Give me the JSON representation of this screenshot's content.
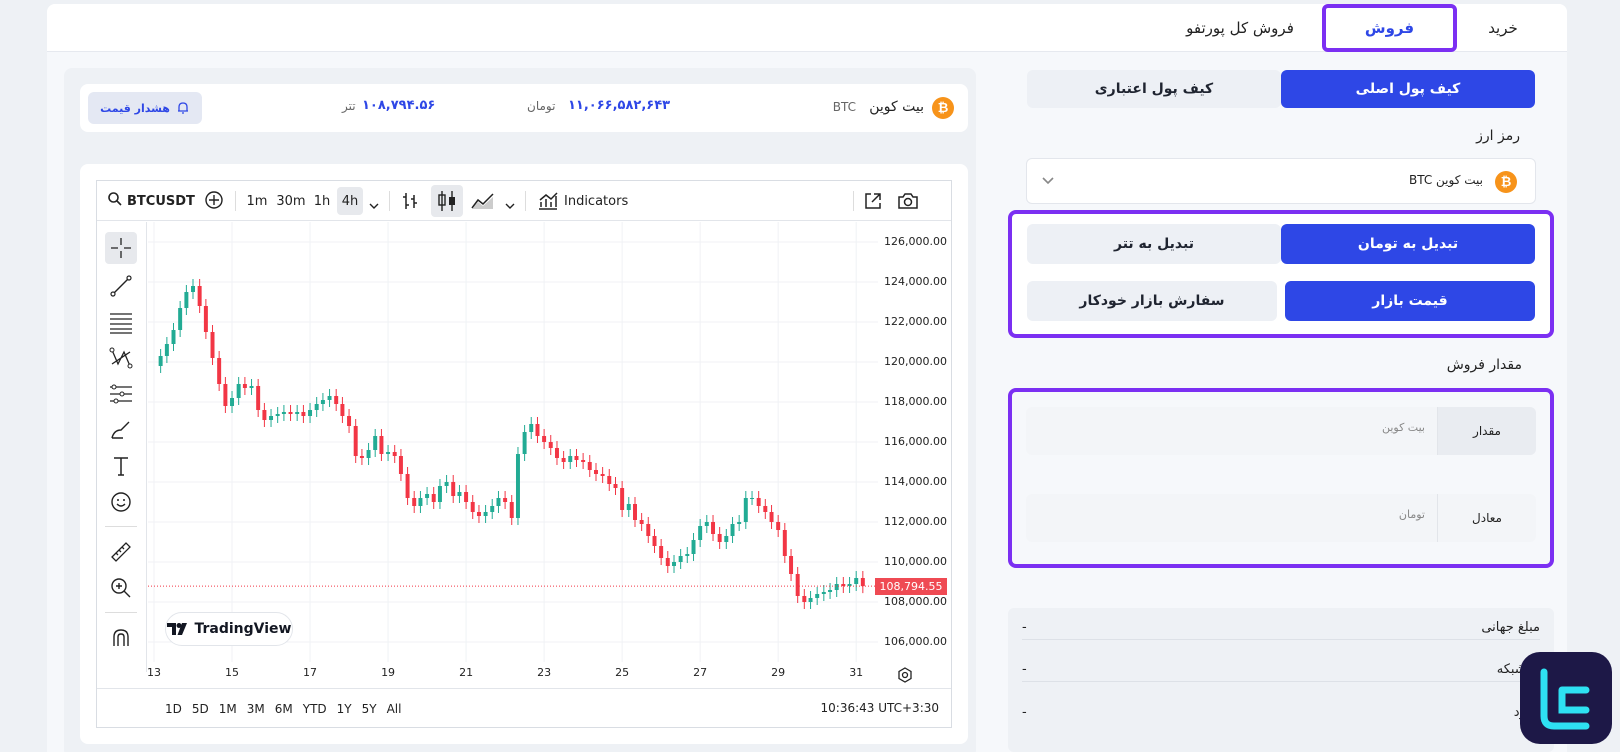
{
  "tabs": {
    "buy": "خرید",
    "sell": "فروش",
    "sell_all": "فروش کل پورتفو"
  },
  "wallet": {
    "main": "کیف پول اصلی",
    "credit": "کیف پول اعتباری"
  },
  "currency": {
    "label": "رمز ارز",
    "selected": "بیت کوین BTC",
    "coin_symbol": "₿"
  },
  "convert": {
    "to_toman": "تبدیل به تومان",
    "to_tether": "تبدیل به تتر"
  },
  "order_type": {
    "market": "قیمت بازار",
    "auto": "سفارش بازار خودکار"
  },
  "amount": {
    "label": "مقدار فروش",
    "qty_label": "مقدار",
    "qty_placeholder": "بیت کوین",
    "equiv_label": "معادل",
    "equiv_placeholder": "تومان"
  },
  "info": [
    {
      "label": "مبلغ جهانی",
      "value": "-"
    },
    {
      "label": "ی شبکه",
      "value": "-"
    },
    {
      "label": "رمزد",
      "value": "-"
    }
  ],
  "ticker": {
    "name": "بیت کوین",
    "symbol": "BTC",
    "toman_price": "۱۱,۰۶۶,۵۸۲,۶۴۳",
    "toman_unit": "تومان",
    "tether_price": "۱۰۸,۷۹۴.۵۶",
    "tether_unit": "تتر",
    "alert": "هشدار قیمت"
  },
  "toolbar": {
    "symbol": "BTCUSDT",
    "intervals": [
      "1m",
      "30m",
      "1h",
      "4h"
    ],
    "indicators": "Indicators"
  },
  "chart_data": {
    "type": "candlestick",
    "symbol": "BTCUSDT",
    "interval": "4h",
    "ylim": [
      105000,
      127000
    ],
    "y_ticks": [
      126000,
      124000,
      122000,
      120000,
      118000,
      116000,
      114000,
      112000,
      110000,
      108000,
      106000
    ],
    "y_tick_labels": [
      "126,000.00",
      "124,000.00",
      "122,000.00",
      "120,000.00",
      "118,000.00",
      "116,000.00",
      "114,000.00",
      "112,000.00",
      "110,000.00",
      "108,000.00",
      "106,000.00"
    ],
    "x_tick_labels": [
      "13",
      "15",
      "17",
      "19",
      "21",
      "23",
      "25",
      "27",
      "29",
      "31"
    ],
    "x_range_days": [
      13,
      31.2
    ],
    "last_price": 108794.55,
    "last_price_label": "108,794.55",
    "closes": [
      [
        13.0,
        119800
      ],
      [
        13.17,
        120300
      ],
      [
        13.33,
        120900
      ],
      [
        13.5,
        121600
      ],
      [
        13.67,
        122700
      ],
      [
        13.83,
        123500
      ],
      [
        14.0,
        123800
      ],
      [
        14.17,
        122800
      ],
      [
        14.33,
        121500
      ],
      [
        14.5,
        120200
      ],
      [
        14.67,
        118900
      ],
      [
        14.83,
        117800
      ],
      [
        15.0,
        118200
      ],
      [
        15.17,
        118900
      ],
      [
        15.33,
        118700
      ],
      [
        15.5,
        118800
      ],
      [
        15.67,
        117600
      ],
      [
        15.83,
        117100
      ],
      [
        16.0,
        117300
      ],
      [
        16.17,
        117400
      ],
      [
        16.33,
        117500
      ],
      [
        16.5,
        117400
      ],
      [
        16.67,
        117500
      ],
      [
        16.83,
        117300
      ],
      [
        17.0,
        117600
      ],
      [
        17.17,
        117900
      ],
      [
        17.33,
        118100
      ],
      [
        17.5,
        118300
      ],
      [
        17.67,
        117900
      ],
      [
        17.83,
        117300
      ],
      [
        18.0,
        116800
      ],
      [
        18.17,
        115300
      ],
      [
        18.33,
        115200
      ],
      [
        18.5,
        115600
      ],
      [
        18.67,
        116300
      ],
      [
        18.83,
        115400
      ],
      [
        19.0,
        115500
      ],
      [
        19.17,
        115300
      ],
      [
        19.33,
        114400
      ],
      [
        19.5,
        113200
      ],
      [
        19.67,
        112800
      ],
      [
        19.83,
        113200
      ],
      [
        20.0,
        113400
      ],
      [
        20.17,
        113000
      ],
      [
        20.33,
        113800
      ],
      [
        20.5,
        114000
      ],
      [
        20.67,
        113300
      ],
      [
        20.83,
        113500
      ],
      [
        21.0,
        113000
      ],
      [
        21.17,
        112500
      ],
      [
        21.33,
        112300
      ],
      [
        21.5,
        112500
      ],
      [
        21.67,
        112800
      ],
      [
        21.83,
        113200
      ],
      [
        22.0,
        113000
      ],
      [
        22.17,
        112200
      ],
      [
        22.33,
        115400
      ],
      [
        22.5,
        116500
      ],
      [
        22.67,
        116900
      ],
      [
        22.83,
        116300
      ],
      [
        23.0,
        116000
      ],
      [
        23.17,
        115700
      ],
      [
        23.33,
        115200
      ],
      [
        23.5,
        115000
      ],
      [
        23.67,
        115300
      ],
      [
        23.83,
        115100
      ],
      [
        24.0,
        115000
      ],
      [
        24.17,
        114600
      ],
      [
        24.33,
        114400
      ],
      [
        24.5,
        114300
      ],
      [
        24.67,
        113900
      ],
      [
        24.83,
        113700
      ],
      [
        25.0,
        112600
      ],
      [
        25.17,
        112900
      ],
      [
        25.33,
        112100
      ],
      [
        25.5,
        111900
      ],
      [
        25.67,
        111300
      ],
      [
        25.83,
        110800
      ],
      [
        26.0,
        110200
      ],
      [
        26.17,
        109800
      ],
      [
        26.33,
        110000
      ],
      [
        26.5,
        110300
      ],
      [
        26.67,
        110400
      ],
      [
        26.83,
        111100
      ],
      [
        27.0,
        111800
      ],
      [
        27.17,
        112000
      ],
      [
        27.33,
        111400
      ],
      [
        27.5,
        111000
      ],
      [
        27.67,
        111300
      ],
      [
        27.83,
        111900
      ],
      [
        28.0,
        112000
      ],
      [
        28.17,
        113200
      ],
      [
        28.33,
        113200
      ],
      [
        28.5,
        112800
      ],
      [
        28.67,
        112500
      ],
      [
        28.83,
        112000
      ],
      [
        29.0,
        111600
      ],
      [
        29.17,
        110300
      ],
      [
        29.33,
        109400
      ],
      [
        29.5,
        108300
      ],
      [
        29.67,
        108000
      ],
      [
        29.83,
        108200
      ],
      [
        30.0,
        108400
      ],
      [
        30.17,
        108500
      ],
      [
        30.33,
        108600
      ],
      [
        30.5,
        108900
      ],
      [
        30.67,
        108800
      ],
      [
        30.83,
        108900
      ],
      [
        31.0,
        109200
      ],
      [
        31.17,
        108794
      ]
    ]
  },
  "ranges": [
    "1D",
    "5D",
    "1M",
    "3M",
    "6M",
    "YTD",
    "1Y",
    "5Y",
    "All"
  ],
  "clock": "10:36:43 UTC+3:30",
  "watermark": "TradingView"
}
